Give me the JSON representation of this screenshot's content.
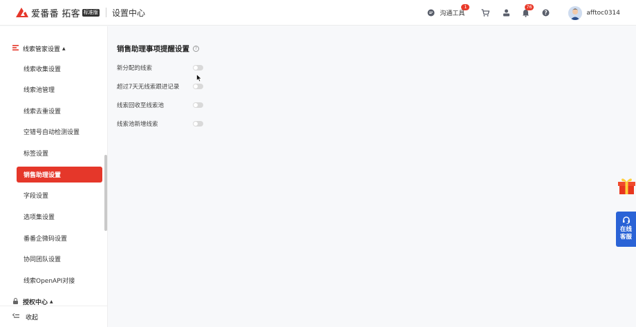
{
  "header": {
    "brand_name": "爱番番 拓客",
    "edition_badge": "标准版",
    "page_title": "设置中心",
    "tools_label": "沟通工具",
    "tools_badge": "1",
    "notifications_badge": "76",
    "username": "afftoc0314"
  },
  "sidebar": {
    "group_title": "线索管家设置",
    "items": [
      {
        "label": "线索收集设置"
      },
      {
        "label": "线索池管理"
      },
      {
        "label": "线索去重设置"
      },
      {
        "label": "空错号自动检测设置"
      },
      {
        "label": "标签设置"
      },
      {
        "label": "销售助理设置"
      },
      {
        "label": "字段设置"
      },
      {
        "label": "选项集设置"
      },
      {
        "label": "番番企微码设置"
      },
      {
        "label": "协同团队设置"
      },
      {
        "label": "线索OpenAPI对接"
      }
    ],
    "active_item": "销售助理设置",
    "next_group_title": "授权中心",
    "collapse_label": "收起"
  },
  "main": {
    "title": "销售助理事项提醒设置",
    "settings": [
      {
        "label": "新分配的线索",
        "enabled": false
      },
      {
        "label": "超过7天无线索跟进记录",
        "enabled": false
      },
      {
        "label": "线索回收至线索池",
        "enabled": false
      },
      {
        "label": "线索池新增线索",
        "enabled": false
      }
    ]
  },
  "widgets": {
    "customer_service_line1": "在线",
    "customer_service_line2": "客服"
  },
  "colors": {
    "brand_red": "#e5372a",
    "cs_blue": "#2a63d6",
    "badge_red": "#e93a2a"
  }
}
